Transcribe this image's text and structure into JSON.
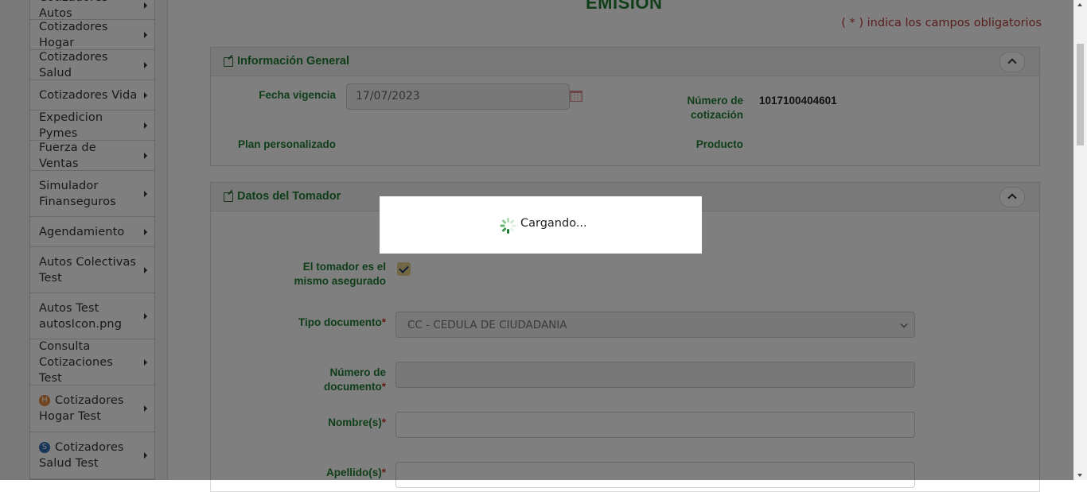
{
  "sidebar": {
    "items": [
      {
        "label": "Cotizadores Autos",
        "height": 36
      },
      {
        "label": "Cotizadores Hogar",
        "height": 38
      },
      {
        "label": "Cotizadores Salud",
        "height": 38
      },
      {
        "label": "Cotizadores Vida",
        "height": 38
      },
      {
        "label": "Expedicion Pymes",
        "height": 38
      },
      {
        "label": "Fuerza de Ventas",
        "height": 38
      },
      {
        "label": "Simulador Finanseguros",
        "height": 58
      },
      {
        "label": "Agendamiento",
        "height": 38
      },
      {
        "label": "Autos Colectivas Test",
        "height": 58
      },
      {
        "label": "Autos Test autosIcon.png",
        "height": 58
      },
      {
        "label": "Consulta Cotizaciones Test",
        "height": 58
      },
      {
        "label": "Cotizadores Hogar Test",
        "height": 59,
        "badge": "H",
        "badge_color": "#e08a3c"
      },
      {
        "label": "Cotizadores Salud Test",
        "height": 59,
        "badge": "S",
        "badge_color": "#2f6fb3"
      }
    ]
  },
  "header": {
    "title": "EMISIÓN",
    "required_note": "( * ) indica los campos obligatorios"
  },
  "general_panel": {
    "title": "Información General",
    "fecha_vigencia_label": "Fecha vigencia",
    "fecha_vigencia_value": "17/07/2023",
    "numero_cotizacion_label": "Número de cotización",
    "numero_cotizacion_value": "1017100404601",
    "plan_label": "Plan personalizado",
    "producto_label": "Producto"
  },
  "tomador_panel": {
    "title": "Datos del Tomador",
    "mismo_asegurado_label": "El tomador es el mismo asegurado",
    "mismo_asegurado_checked": true,
    "tipo_documento_label": "Tipo documento",
    "tipo_documento_value": "CC - CEDULA DE CIUDADANIA",
    "numero_documento_label": "Número de documento",
    "numero_documento_value": "",
    "nombres_label": "Nombre(s)",
    "nombres_value": "",
    "apellidos_label": "Apellido(s)",
    "required_mark": "*"
  },
  "loading": {
    "text": "Cargando..."
  },
  "colors": {
    "accent_green": "#1e7d32",
    "required_red": "#b53a3a",
    "overlay": "rgba(0,0,0,0.5)"
  }
}
